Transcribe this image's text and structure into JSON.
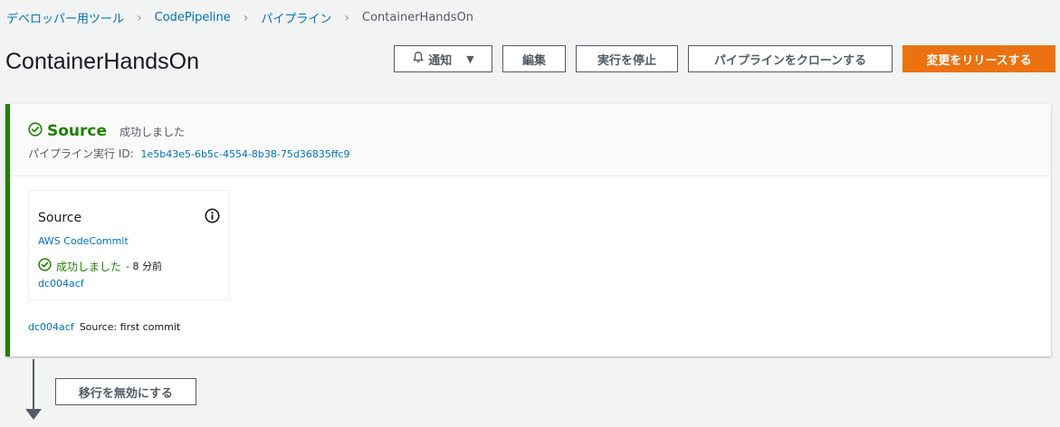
{
  "breadcrumb": {
    "items": [
      "デベロッパー用ツール",
      "CodePipeline",
      "パイプライン"
    ],
    "current": "ContainerHandsOn",
    "separator": "›"
  },
  "page": {
    "title": "ContainerHandsOn"
  },
  "actions": {
    "notify": "通知",
    "edit": "編集",
    "stop": "実行を停止",
    "clone": "パイプラインをクローンする",
    "release": "変更をリリースする"
  },
  "stage": {
    "name": "Source",
    "status": "成功しました",
    "exec_label": "パイプライン実行 ID:",
    "exec_id": "1e5b43e5-6b5c-4554-8b38-75d36835ffc9",
    "action": {
      "title": "Source",
      "provider": "AWS CodeCommit",
      "status": "成功しました",
      "time": "- 8 分前",
      "commit": "dc004acf"
    },
    "commit_row": {
      "id": "dc004acf",
      "message": "Source: first commit"
    }
  },
  "transition": {
    "disable_label": "移行を無効にする"
  },
  "colors": {
    "success": "#1d8102",
    "primary": "#ec7211",
    "link": "#0073bb",
    "background": "#f2f3f3"
  }
}
